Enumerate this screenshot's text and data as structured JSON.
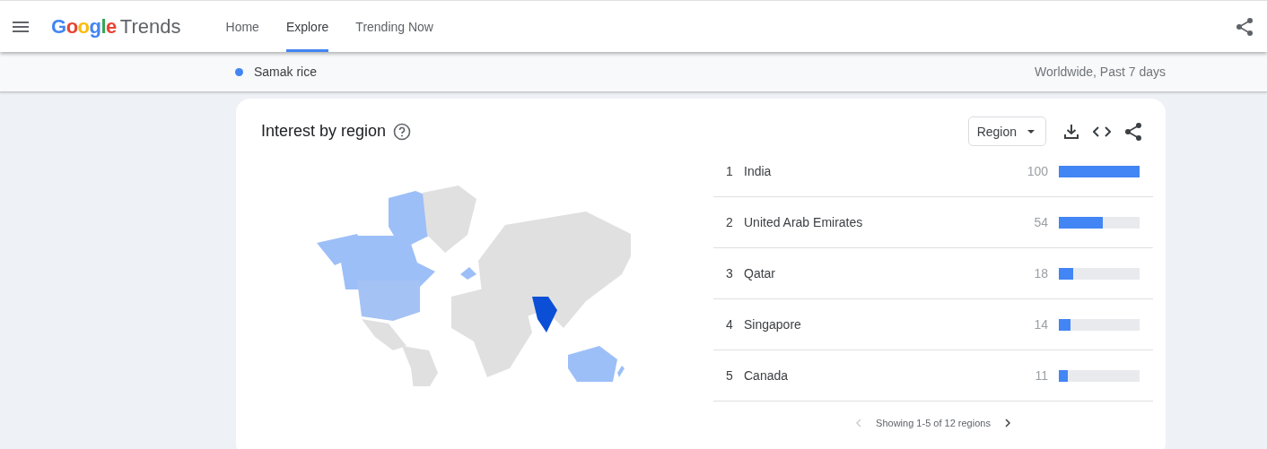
{
  "header": {
    "logo": {
      "brand": "Google",
      "product": "Trends"
    },
    "tabs": [
      {
        "label": "Home",
        "selected": false
      },
      {
        "label": "Explore",
        "selected": true
      },
      {
        "label": "Trending Now",
        "selected": false
      }
    ]
  },
  "query_bar": {
    "term": "Samak rice",
    "color": "#4285f4",
    "scope": "Worldwide, Past 7 days"
  },
  "card": {
    "title": "Interest by region",
    "resolution": "Region",
    "rows": [
      {
        "rank": "1",
        "name": "India",
        "value": "100",
        "level": 1.0
      },
      {
        "rank": "2",
        "name": "United Arab Emirates",
        "value": "54",
        "level": 0.54
      },
      {
        "rank": "3",
        "name": "Qatar",
        "value": "18",
        "level": 0.18
      },
      {
        "rank": "4",
        "name": "Singapore",
        "value": "14",
        "level": 0.14
      },
      {
        "rank": "5",
        "name": "Canada",
        "value": "11",
        "level": 0.11
      }
    ],
    "pagination": "Showing 1-5 of 12 regions"
  }
}
